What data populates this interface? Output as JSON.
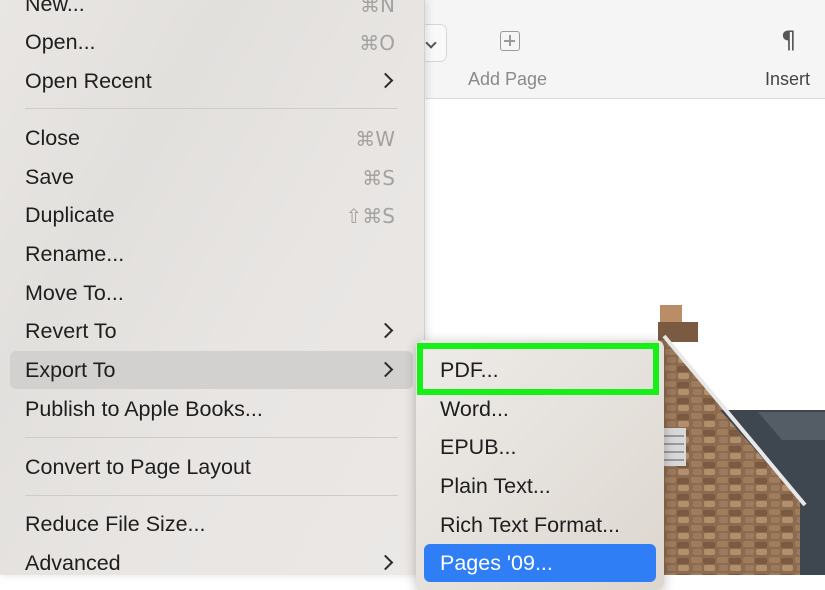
{
  "toolbar": {
    "add_page_label": "Add Page",
    "insert_label": "Insert",
    "insert_icon": "¶"
  },
  "file_menu": {
    "items": [
      {
        "label": "New...",
        "shortcut": "⌘N"
      },
      {
        "label": "Open...",
        "shortcut": "⌘O"
      },
      {
        "label": "Open Recent",
        "submenu": true
      },
      {
        "label": "Close",
        "shortcut": "⌘W"
      },
      {
        "label": "Save",
        "shortcut": "⌘S"
      },
      {
        "label": "Duplicate",
        "shortcut": "⇧⌘S"
      },
      {
        "label": "Rename..."
      },
      {
        "label": "Move To..."
      },
      {
        "label": "Revert To",
        "submenu": true
      },
      {
        "label": "Export To",
        "submenu": true,
        "highlighted": true
      },
      {
        "label": "Publish to Apple Books..."
      },
      {
        "label": "Convert to Page Layout"
      },
      {
        "label": "Reduce File Size..."
      },
      {
        "label": "Advanced",
        "submenu": true
      }
    ]
  },
  "export_submenu": {
    "items": [
      {
        "label": "PDF..."
      },
      {
        "label": "Word..."
      },
      {
        "label": "EPUB..."
      },
      {
        "label": "Plain Text..."
      },
      {
        "label": "Rich Text Format..."
      },
      {
        "label": "Pages '09...",
        "selected": true
      }
    ]
  },
  "colors": {
    "annotation_green": "#16f016",
    "selection_blue": "#2f7ef6"
  }
}
